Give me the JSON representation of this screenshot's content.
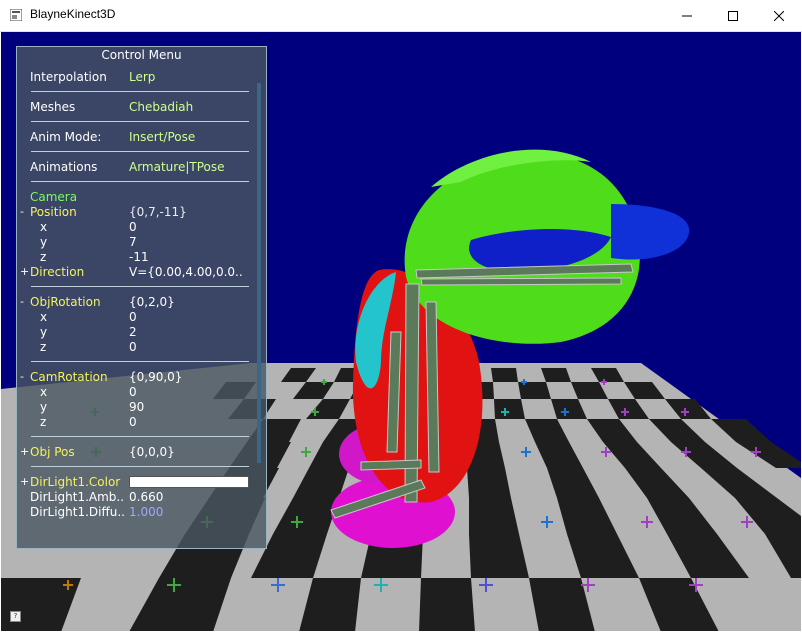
{
  "window": {
    "title": "BlayneKinect3D"
  },
  "menu": {
    "title": "Control Menu",
    "interpolation": {
      "label": "Interpolation",
      "value": "Lerp"
    },
    "meshes": {
      "label": "Meshes",
      "value": "Chebadiah"
    },
    "anim_mode": {
      "label": "Anim Mode:",
      "value": "Insert/Pose"
    },
    "animations": {
      "label": "Animations",
      "value": "Armature|TPose"
    },
    "camera_header": "Camera",
    "position": {
      "toggle": "-",
      "label": "Position",
      "value": "{0,7,-11}",
      "x": "0",
      "y": "7",
      "z": "-11"
    },
    "direction": {
      "toggle": "+",
      "label": "Direction",
      "value": "V={0.00,4.00,0.0.."
    },
    "obj_rotation": {
      "toggle": "-",
      "label": "ObjRotation",
      "value": "{0,2,0}",
      "x": "0",
      "y": "2",
      "z": "0"
    },
    "cam_rotation": {
      "toggle": "-",
      "label": "CamRotation",
      "value": "{0,90,0}",
      "x": "0",
      "y": "90",
      "z": "0"
    },
    "obj_pos": {
      "toggle": "+",
      "label": "Obj Pos",
      "value": "{0,0,0}"
    },
    "dirlight_color": {
      "toggle": "+",
      "label": "DirLight1.Color"
    },
    "dirlight_ambient": {
      "label": "DirLight1.Amb..",
      "value": "0.660"
    },
    "dirlight_diffuse": {
      "label": "DirLight1.Diffu..",
      "value": "1.000"
    },
    "axis_x": "x",
    "axis_y": "y",
    "axis_z": "z"
  },
  "colors": {
    "background": "#00007f",
    "panel": "#4a5660",
    "value_green": "#cfff90",
    "value_yellow": "#f3f35a"
  }
}
